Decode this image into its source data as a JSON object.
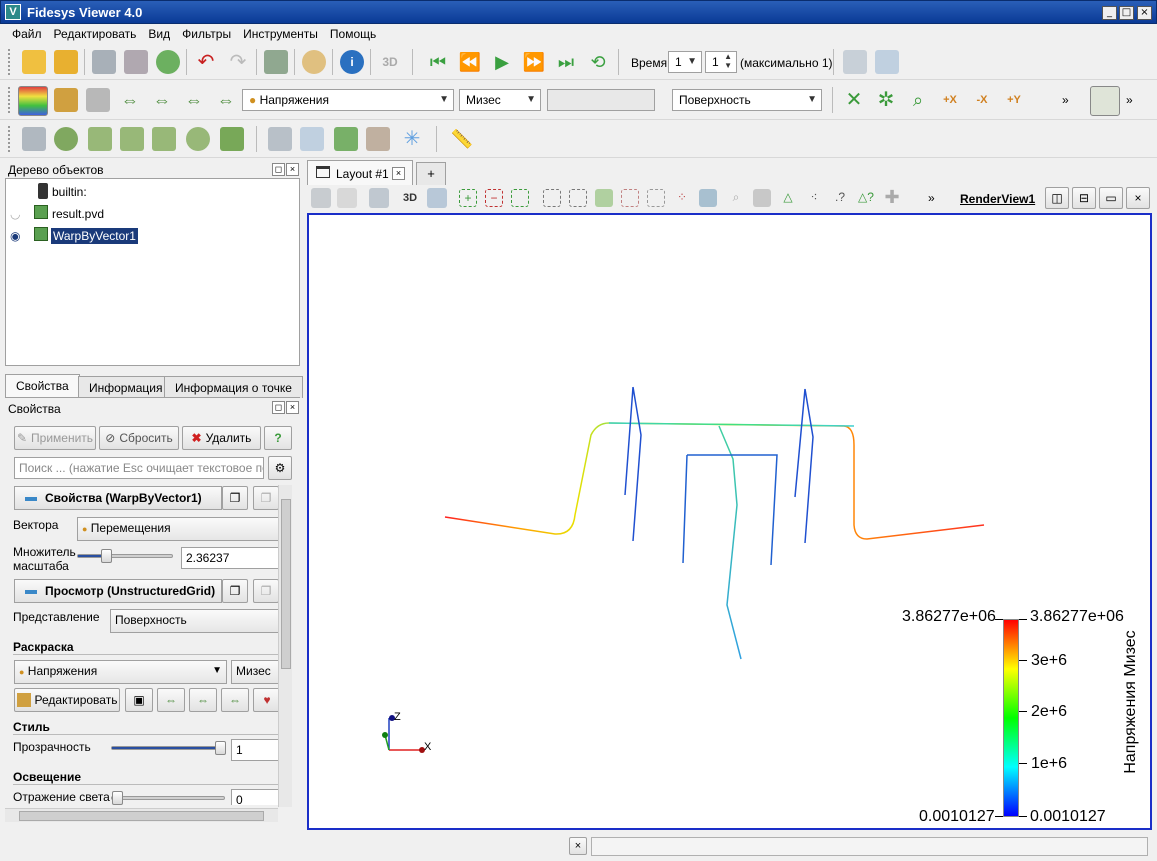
{
  "window": {
    "title": "Fidesys Viewer 4.0",
    "min": "_",
    "max": "□",
    "close": "×"
  },
  "menu": [
    "Файл",
    "Редактировать",
    "Вид",
    "Фильтры",
    "Инструменты",
    "Помощь"
  ],
  "time": {
    "label": "Время:",
    "value": "1",
    "step": "1",
    "max_label": "(максимально 1)",
    "three_d": "3D"
  },
  "color_toolbar": {
    "array": "Напряжения",
    "component": "Мизес",
    "representation": "Поверхность",
    "more": "»"
  },
  "pipeline": {
    "title": "Дерево объектов",
    "items": [
      {
        "label": "builtin:"
      },
      {
        "label": "result.pvd"
      },
      {
        "label": "WarpByVector1"
      }
    ]
  },
  "tabs": {
    "properties": "Свойства",
    "information": "Информация",
    "point_info": "Информация о точке"
  },
  "properties": {
    "title": "Свойства",
    "apply": "Применить",
    "reset": "Сбросить",
    "delete": "Удалить",
    "help": "?",
    "search_placeholder": "Поиск ... (нажатие Esc очищает текстовое по...",
    "section_props": "Свойства (WarpByVector1)",
    "vectors_label": "Вектора",
    "vectors_value": "Перемещения",
    "scale_label_1": "Множитель",
    "scale_label_2": "масштаба",
    "scale_value": "2.36237",
    "scale_frac": 0.27,
    "section_view": "Просмотр (UnstructuredGrid)",
    "representation_label": "Представление",
    "representation_value": "Поверхность",
    "coloring_label": "Раскраска",
    "coloring_array": "Напряжения",
    "coloring_component": "Мизес",
    "edit_button": "Редактировать",
    "style_label": "Стиль",
    "opacity_label": "Прозрачность",
    "opacity_value": "1",
    "opacity_frac": 1.0,
    "lighting_label": "Освещение",
    "specular_label": "Отражение света",
    "specular_value": "0",
    "specular_frac": 0.0
  },
  "layout": {
    "tab": "Layout #1",
    "add": "+",
    "view_name": "RenderView1",
    "three_d": "3D",
    "more": "»"
  },
  "colorbar": {
    "title": "Напряжения Мизес",
    "max_left": "3.86277e+06",
    "max_right": "3.86277e+06",
    "min_left": "0.0010127",
    "min_right": "0.0010127",
    "ticks": [
      "3e+6",
      "2e+6",
      "1e+6"
    ],
    "colors": [
      "#ff0000",
      "#ffff00",
      "#00ff00",
      "#00ffff",
      "#0000ff"
    ]
  },
  "axes": {
    "z": "Z",
    "x": "X"
  },
  "status": {
    "close": "×"
  }
}
